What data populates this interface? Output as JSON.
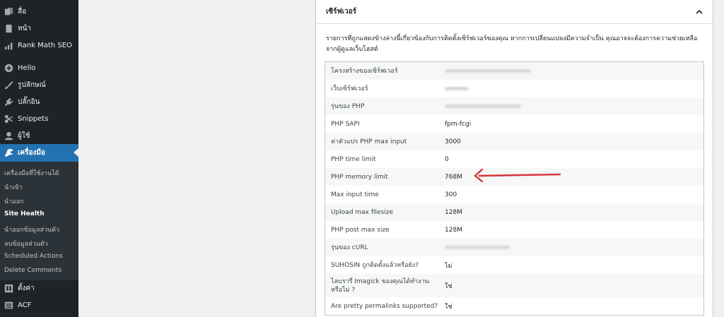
{
  "sidebar": {
    "items": [
      {
        "label": "สื่อ",
        "icon": "media-icon"
      },
      {
        "label": "หน้า",
        "icon": "pages-icon"
      },
      {
        "label": "Rank Math SEO",
        "icon": "rank-math-icon"
      },
      {
        "label": "Hello",
        "icon": "hello-icon"
      },
      {
        "label": "รูปลักษณ์",
        "icon": "appearance-icon"
      },
      {
        "label": "ปลั๊กอิน",
        "icon": "plugins-icon"
      },
      {
        "label": "Snippets",
        "icon": "snippets-icon"
      },
      {
        "label": "ผู้ใช้",
        "icon": "users-icon"
      },
      {
        "label": "เครื่องมือ",
        "icon": "tools-icon"
      },
      {
        "label": "ตั้งค่า",
        "icon": "settings-icon"
      },
      {
        "label": "ACF",
        "icon": "acf-icon"
      }
    ],
    "submenu": [
      "เครื่องมือที่ใช้งานได้",
      "นำเข้า",
      "นำออก",
      "Site Health",
      "นำออกข้อมูลส่วนตัว",
      "ลบข้อมูลส่วนตัว",
      "Scheduled Actions",
      "Delete Comments"
    ]
  },
  "panel": {
    "title": "เซิร์ฟเวอร์",
    "description": "รายการที่ถูกแสดงข้างล่างนี้เกี่ยวข้องกับการติดตั้งเซิร์ฟเวอร์ของคุณ หากการเปลี่ยนแปลงมีความจำเป็น คุณอาจจะต้องการความช่วยเหลือจากผู้ดูแลเว็บโฮสต์",
    "rows": [
      {
        "label": "โครงสร้างของเซิร์ฟเวอร์",
        "value": ""
      },
      {
        "label": "เว็บเซิร์ฟเวอร์",
        "value": ""
      },
      {
        "label": "รุ่นของ PHP",
        "value": ""
      },
      {
        "label": "PHP SAPI",
        "value": "fpm-fcgi"
      },
      {
        "label": "ค่าตัวแปร PHP max input",
        "value": "3000"
      },
      {
        "label": "PHP time limit",
        "value": "0"
      },
      {
        "label": "PHP memory limit",
        "value": "768M"
      },
      {
        "label": "Max input time",
        "value": "300"
      },
      {
        "label": "Upload max filesize",
        "value": "128M"
      },
      {
        "label": "PHP post max size",
        "value": "128M"
      },
      {
        "label": "รุ่นของ cURL",
        "value": ""
      },
      {
        "label": "SUHOSIN ถูกติดตั้งแล้วหรือยัง?",
        "value": "ไม่"
      },
      {
        "label": "ไลบรารี่ Imagick ของคุณได้ทำงานหรือไม่ ?",
        "value": "ใช่"
      },
      {
        "label": "Are pretty permalinks supported?",
        "value": "ใช่"
      }
    ]
  },
  "colors": {
    "sidebar_bg": "#1d2327",
    "active_bg": "#2271b1",
    "arrow": "#d63638"
  }
}
